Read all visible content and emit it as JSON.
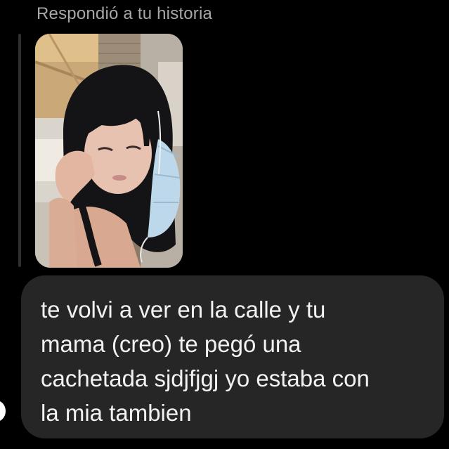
{
  "reply": {
    "header": "Respondió a tu historia"
  },
  "story": {
    "kind": "photo"
  },
  "message": {
    "lines": [
      "te volvi a ver en la calle y tu",
      "mama (creo) te pegó una",
      "cachetada sjdjfjgj yo estaba con",
      "la mia tambien"
    ]
  },
  "colors": {
    "background": "#000000",
    "bubble": "#262626",
    "header_text": "#a8a8a8",
    "message_text": "#f2f2f2"
  }
}
